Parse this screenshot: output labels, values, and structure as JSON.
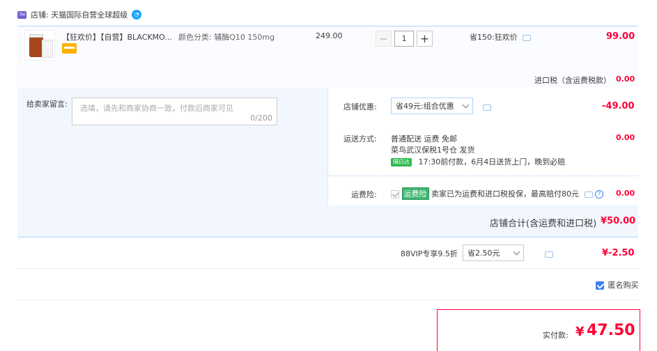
{
  "shop": {
    "label": "店铺: 天猫国际自营全球超级",
    "icon_text": "TM"
  },
  "item": {
    "title": "【狂欢价】【自营】BLACKMO...",
    "spec": "颜色分类: 辅酶Q10 150mg",
    "unit_price": "249.00",
    "quantity": "1",
    "discount_note": "省150:狂欢价",
    "subtotal": "99.00",
    "tax_label": "进口税（含运费税款）",
    "tax_value": "0.00"
  },
  "message": {
    "label": "给卖家留言:",
    "placeholder": "选填，请先和商家协商一致，付款后商家可见",
    "counter": "0/200"
  },
  "shop_discount": {
    "label": "店铺优惠:",
    "selected": "省49元:组合优惠",
    "value": "-49.00"
  },
  "shipping": {
    "label": "运送方式:",
    "line1": "普通配送 运费 免邮",
    "line2": "菜鸟武汉保税1号仓  发货",
    "badge": "隔日达",
    "line3": "17:30前付款，6月4日送货上门，晚到必赔",
    "value": "0.00"
  },
  "insurance": {
    "label": "运费险:",
    "tag": "运费险",
    "text": "卖家已为运费和进口税投保，最高赔付80元",
    "value": "0.00"
  },
  "shop_total": {
    "label": "店铺合计(含运费和进口税)",
    "value": "¥50.00"
  },
  "vip": {
    "label": "88VIP专享9.5折",
    "selected": "省2.50元",
    "value": "¥-2.50"
  },
  "anonymous": {
    "label": "匿名购买",
    "checked": true
  },
  "payment": {
    "label": "实付款:",
    "currency": "¥",
    "value": "47.50"
  },
  "colors": {
    "accent_red": "#ff0036",
    "border_blue": "#b2d1ff",
    "bg_blue": "#f2f7ff"
  }
}
